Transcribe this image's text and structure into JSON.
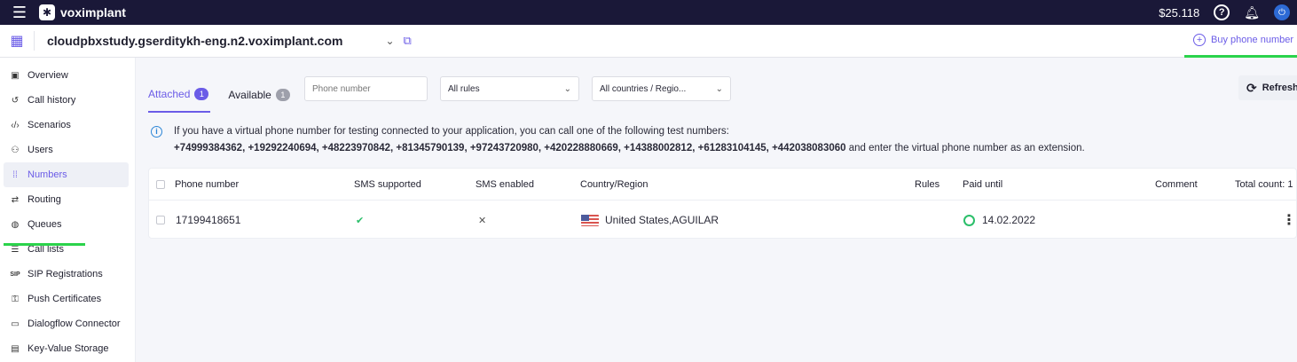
{
  "topbar": {
    "brand": "voximplant",
    "balance": "$25.118"
  },
  "appbar": {
    "app_name": "cloudpbxstudy.gserditykh-eng.n2.voximplant.com",
    "buy_label": "Buy phone number"
  },
  "sidebar": {
    "items": [
      {
        "label": "Overview"
      },
      {
        "label": "Call history"
      },
      {
        "label": "Scenarios"
      },
      {
        "label": "Users"
      },
      {
        "label": "Numbers"
      },
      {
        "label": "Routing"
      },
      {
        "label": "Queues"
      },
      {
        "label": "Call lists"
      },
      {
        "label": "SIP Registrations"
      },
      {
        "label": "Push Certificates"
      },
      {
        "label": "Dialogflow Connector"
      },
      {
        "label": "Key-Value Storage"
      }
    ]
  },
  "tabs": [
    {
      "label": "Attached",
      "count": "1"
    },
    {
      "label": "Available",
      "count": "1"
    }
  ],
  "filters": {
    "phone_placeholder": "Phone number",
    "rules_value": "All rules",
    "countries_value": "All countries / Regio..."
  },
  "refresh_label": "Refresh",
  "info": {
    "line1": "If you have a virtual phone number for testing connected to your application, you can call one of the following test numbers:",
    "numbers": "+74999384362, +19292240694, +48223970842, +81345790139, +97243720980, +420228880669, +14388002812, +61283104145, +442038083060",
    "line2_suffix": " and enter the virtual phone number as an extension."
  },
  "table": {
    "headers": {
      "phone": "Phone number",
      "sms_supported": "SMS supported",
      "sms_enabled": "SMS enabled",
      "country": "Country/Region",
      "rules": "Rules",
      "paid_until": "Paid until",
      "comment": "Comment",
      "total": "Total count: 1"
    },
    "rows": [
      {
        "phone": "17199418651",
        "sms_supported": "✔",
        "sms_enabled": "✕",
        "country": "United States,AGUILAR",
        "rules": "",
        "paid_until": "14.02.2022",
        "comment": ""
      }
    ]
  },
  "colors": {
    "accent": "#6b5ce7",
    "topbar": "#1a1838",
    "highlight": "#2bd34b",
    "status_ok": "#2bbf6a"
  }
}
